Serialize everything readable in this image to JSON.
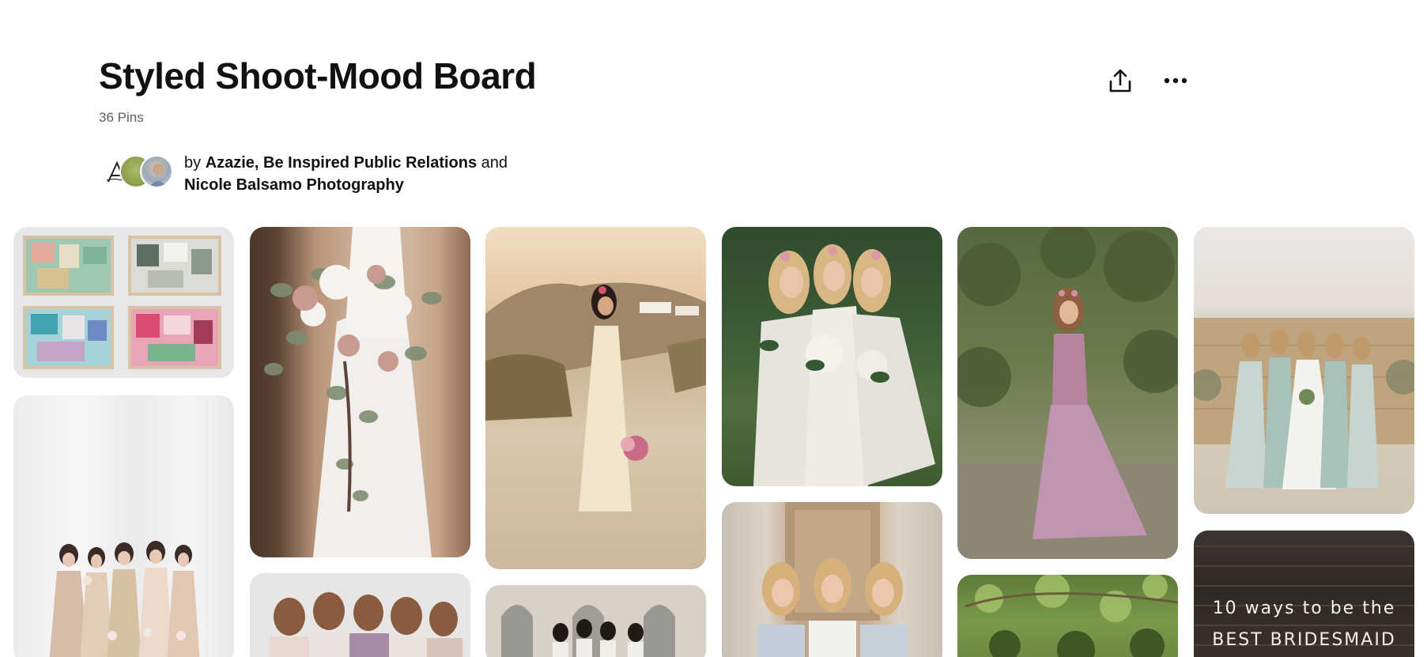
{
  "board": {
    "title": "Styled Shoot-Mood Board",
    "pin_count": "36 Pins",
    "by_prefix": "by",
    "collaborators_first": "Azazie, Be Inspired Public Relations",
    "and_word": "and",
    "collaborator_last": "Nicole Balsamo Photography"
  },
  "actions": {
    "share_icon": "share-icon",
    "more_icon": "more-icon"
  },
  "pins": {
    "bridesmaid_tips_text_1": "10 ways to be the",
    "bridesmaid_tips_text_2": "BEST BRIDESMAID"
  }
}
